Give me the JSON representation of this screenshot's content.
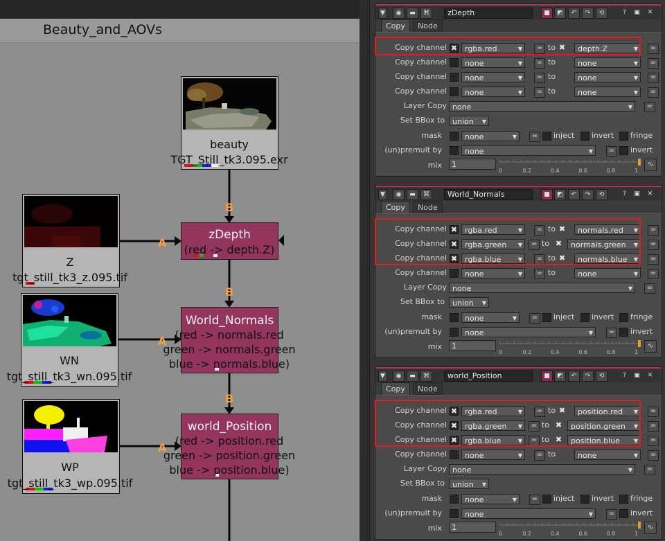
{
  "backdrop": {
    "label": "Beauty_and_AOVs"
  },
  "graph": {
    "pin_labels": [
      "B",
      "A",
      "B",
      "A",
      "B",
      "A"
    ],
    "read_nodes": [
      {
        "id": "beauty",
        "name": "beauty",
        "file": "TGT_Still_tk3.095.exr"
      },
      {
        "id": "z",
        "name": "Z",
        "file": "tgt_still_tk3_z.095.tif"
      },
      {
        "id": "wn",
        "name": "WN",
        "file": "tgt_still_tk3_wn.095.tif"
      },
      {
        "id": "wp",
        "name": "WP",
        "file": "tgt_still_tk3_wp.095.tif"
      }
    ],
    "copy_nodes": [
      {
        "id": "zdepth",
        "title": "zDepth",
        "lines": [
          "(red -> depth.Z)"
        ]
      },
      {
        "id": "world-normals",
        "title": "World_Normals",
        "lines": [
          "(red -> normals.red",
          "green -> normals.green",
          "blue -> normals.blue)"
        ]
      },
      {
        "id": "world-position",
        "title": "world_Position",
        "lines": [
          "(red -> position.red",
          "green -> position.green",
          "blue -> position.blue)"
        ]
      }
    ]
  },
  "labels": {
    "copy_channel": "Copy channel",
    "layer_copy": "Layer Copy",
    "set_bbox": "Set BBox to",
    "mask": "mask",
    "inject": "inject",
    "invert": "invert",
    "fringe": "fringe",
    "unpremult": "(un)premult by",
    "mix": "mix",
    "to": "to",
    "eq": "=",
    "tab_copy": "Copy",
    "tab_node": "Node",
    "x_mark": "✖",
    "ticks": [
      "0",
      "0.2",
      "0.4",
      "0.6",
      "0.8",
      "1"
    ]
  },
  "panels": [
    {
      "name": "zDepth",
      "rows": [
        {
          "checked": true,
          "src": "rgba.red",
          "dst": "depth.Z"
        },
        {
          "checked": false,
          "src": "none",
          "dst": "none"
        },
        {
          "checked": false,
          "src": "none",
          "dst": "none"
        },
        {
          "checked": false,
          "src": "none",
          "dst": "none"
        }
      ],
      "layer_copy": "none",
      "bbox": "union",
      "mask": "none",
      "unpremult": "none",
      "mix": "1"
    },
    {
      "name": "World_Normals",
      "rows": [
        {
          "checked": true,
          "src": "rgba.red",
          "dst": "normals.red"
        },
        {
          "checked": true,
          "src": "rgba.green",
          "dst": "normals.green"
        },
        {
          "checked": true,
          "src": "rgba.blue",
          "dst": "normals.blue"
        },
        {
          "checked": false,
          "src": "none",
          "dst": "none"
        }
      ],
      "layer_copy": "none",
      "bbox": "union",
      "mask": "none",
      "unpremult": "none",
      "mix": "1"
    },
    {
      "name": "world_Position",
      "rows": [
        {
          "checked": true,
          "src": "rgba.red",
          "dst": "position.red"
        },
        {
          "checked": true,
          "src": "rgba.green",
          "dst": "position.green"
        },
        {
          "checked": true,
          "src": "rgba.blue",
          "dst": "position.blue"
        },
        {
          "checked": false,
          "src": "none",
          "dst": "none"
        }
      ],
      "layer_copy": "none",
      "bbox": "union",
      "mask": "none",
      "unpremult": "none",
      "mix": "1"
    }
  ],
  "colors": {
    "copy_node": "#93355d",
    "pin": "#f2a040",
    "highlight": "#e21b23",
    "tab_accent": "#b3345c"
  }
}
